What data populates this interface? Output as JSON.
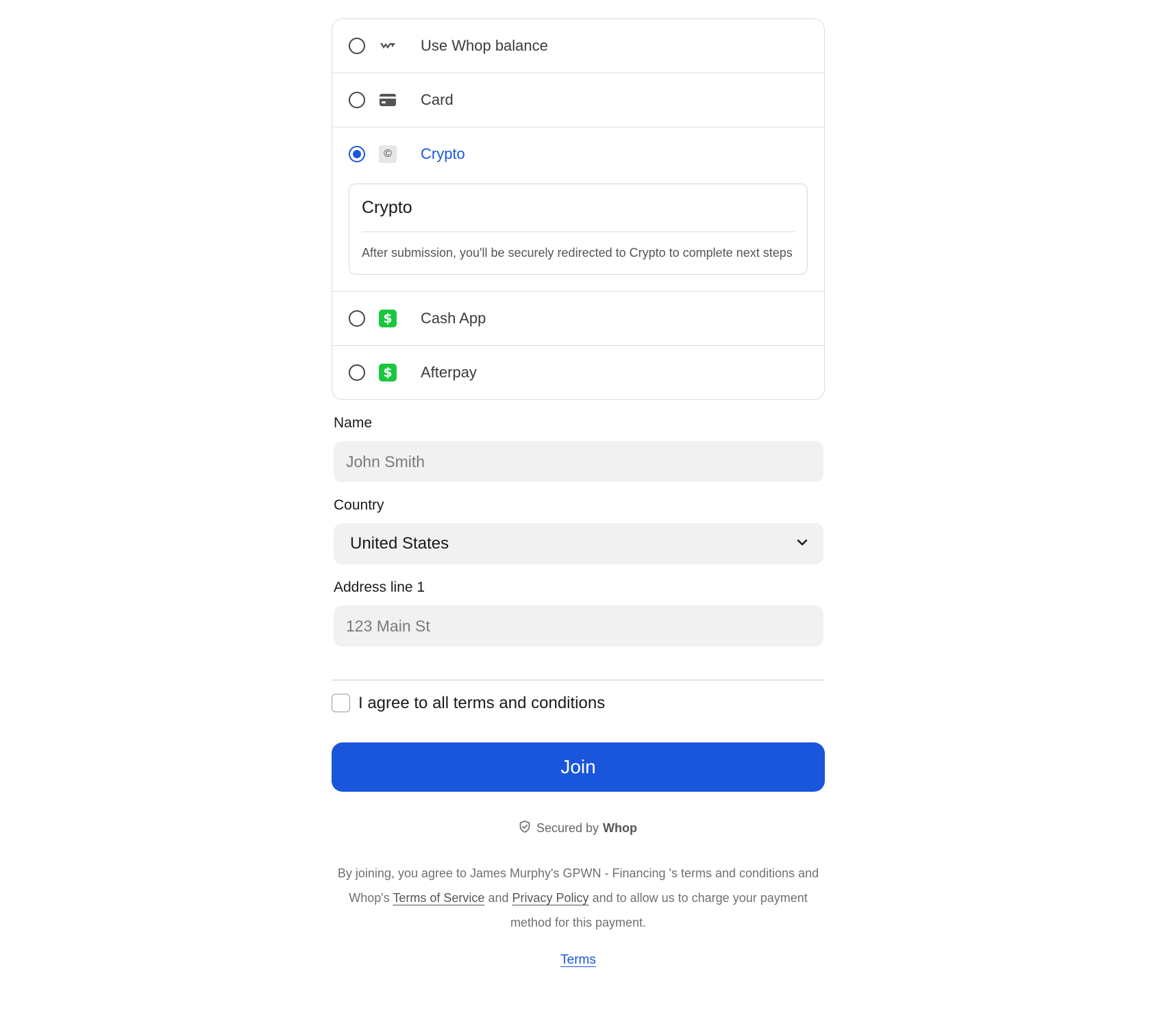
{
  "payment_methods": {
    "options": [
      {
        "label": "Use Whop balance",
        "icon": "whop-logo-icon",
        "selected": false
      },
      {
        "label": "Card",
        "icon": "credit-card-icon",
        "selected": false
      },
      {
        "label": "Crypto",
        "icon": "crypto-coin-icon",
        "icon_glyph": "©",
        "selected": true
      },
      {
        "label": "Cash App",
        "icon": "cash-app-icon",
        "icon_glyph": "$",
        "selected": false
      },
      {
        "label": "Afterpay",
        "icon": "afterpay-icon",
        "icon_glyph": "$",
        "selected": false
      }
    ],
    "crypto_panel": {
      "title": "Crypto",
      "description": "After submission, you'll be securely redirected to Crypto to complete next steps"
    }
  },
  "form": {
    "name": {
      "label": "Name",
      "placeholder": "John Smith",
      "value": ""
    },
    "country": {
      "label": "Country",
      "value": "United States"
    },
    "address": {
      "label": "Address line 1",
      "placeholder": "123 Main St",
      "value": ""
    },
    "agree_label": "I agree to all terms and conditions",
    "agree_checked": false,
    "submit_label": "Join"
  },
  "footer": {
    "secured_prefix": "Secured by",
    "secured_brand": "Whop",
    "legal_part1": "By joining, you agree to James Murphy's GPWN - Financing 's terms and conditions and Whop's",
    "tos_link": "Terms of Service",
    "legal_and": "and",
    "privacy_link": "Privacy Policy",
    "legal_part2": "and to allow us to charge your payment method for this payment.",
    "terms_link": "Terms"
  },
  "colors": {
    "accent": "#1a56db",
    "cash_app_green": "#19c73e",
    "input_bg": "#f1f1f1",
    "border": "#dcdcdc"
  }
}
